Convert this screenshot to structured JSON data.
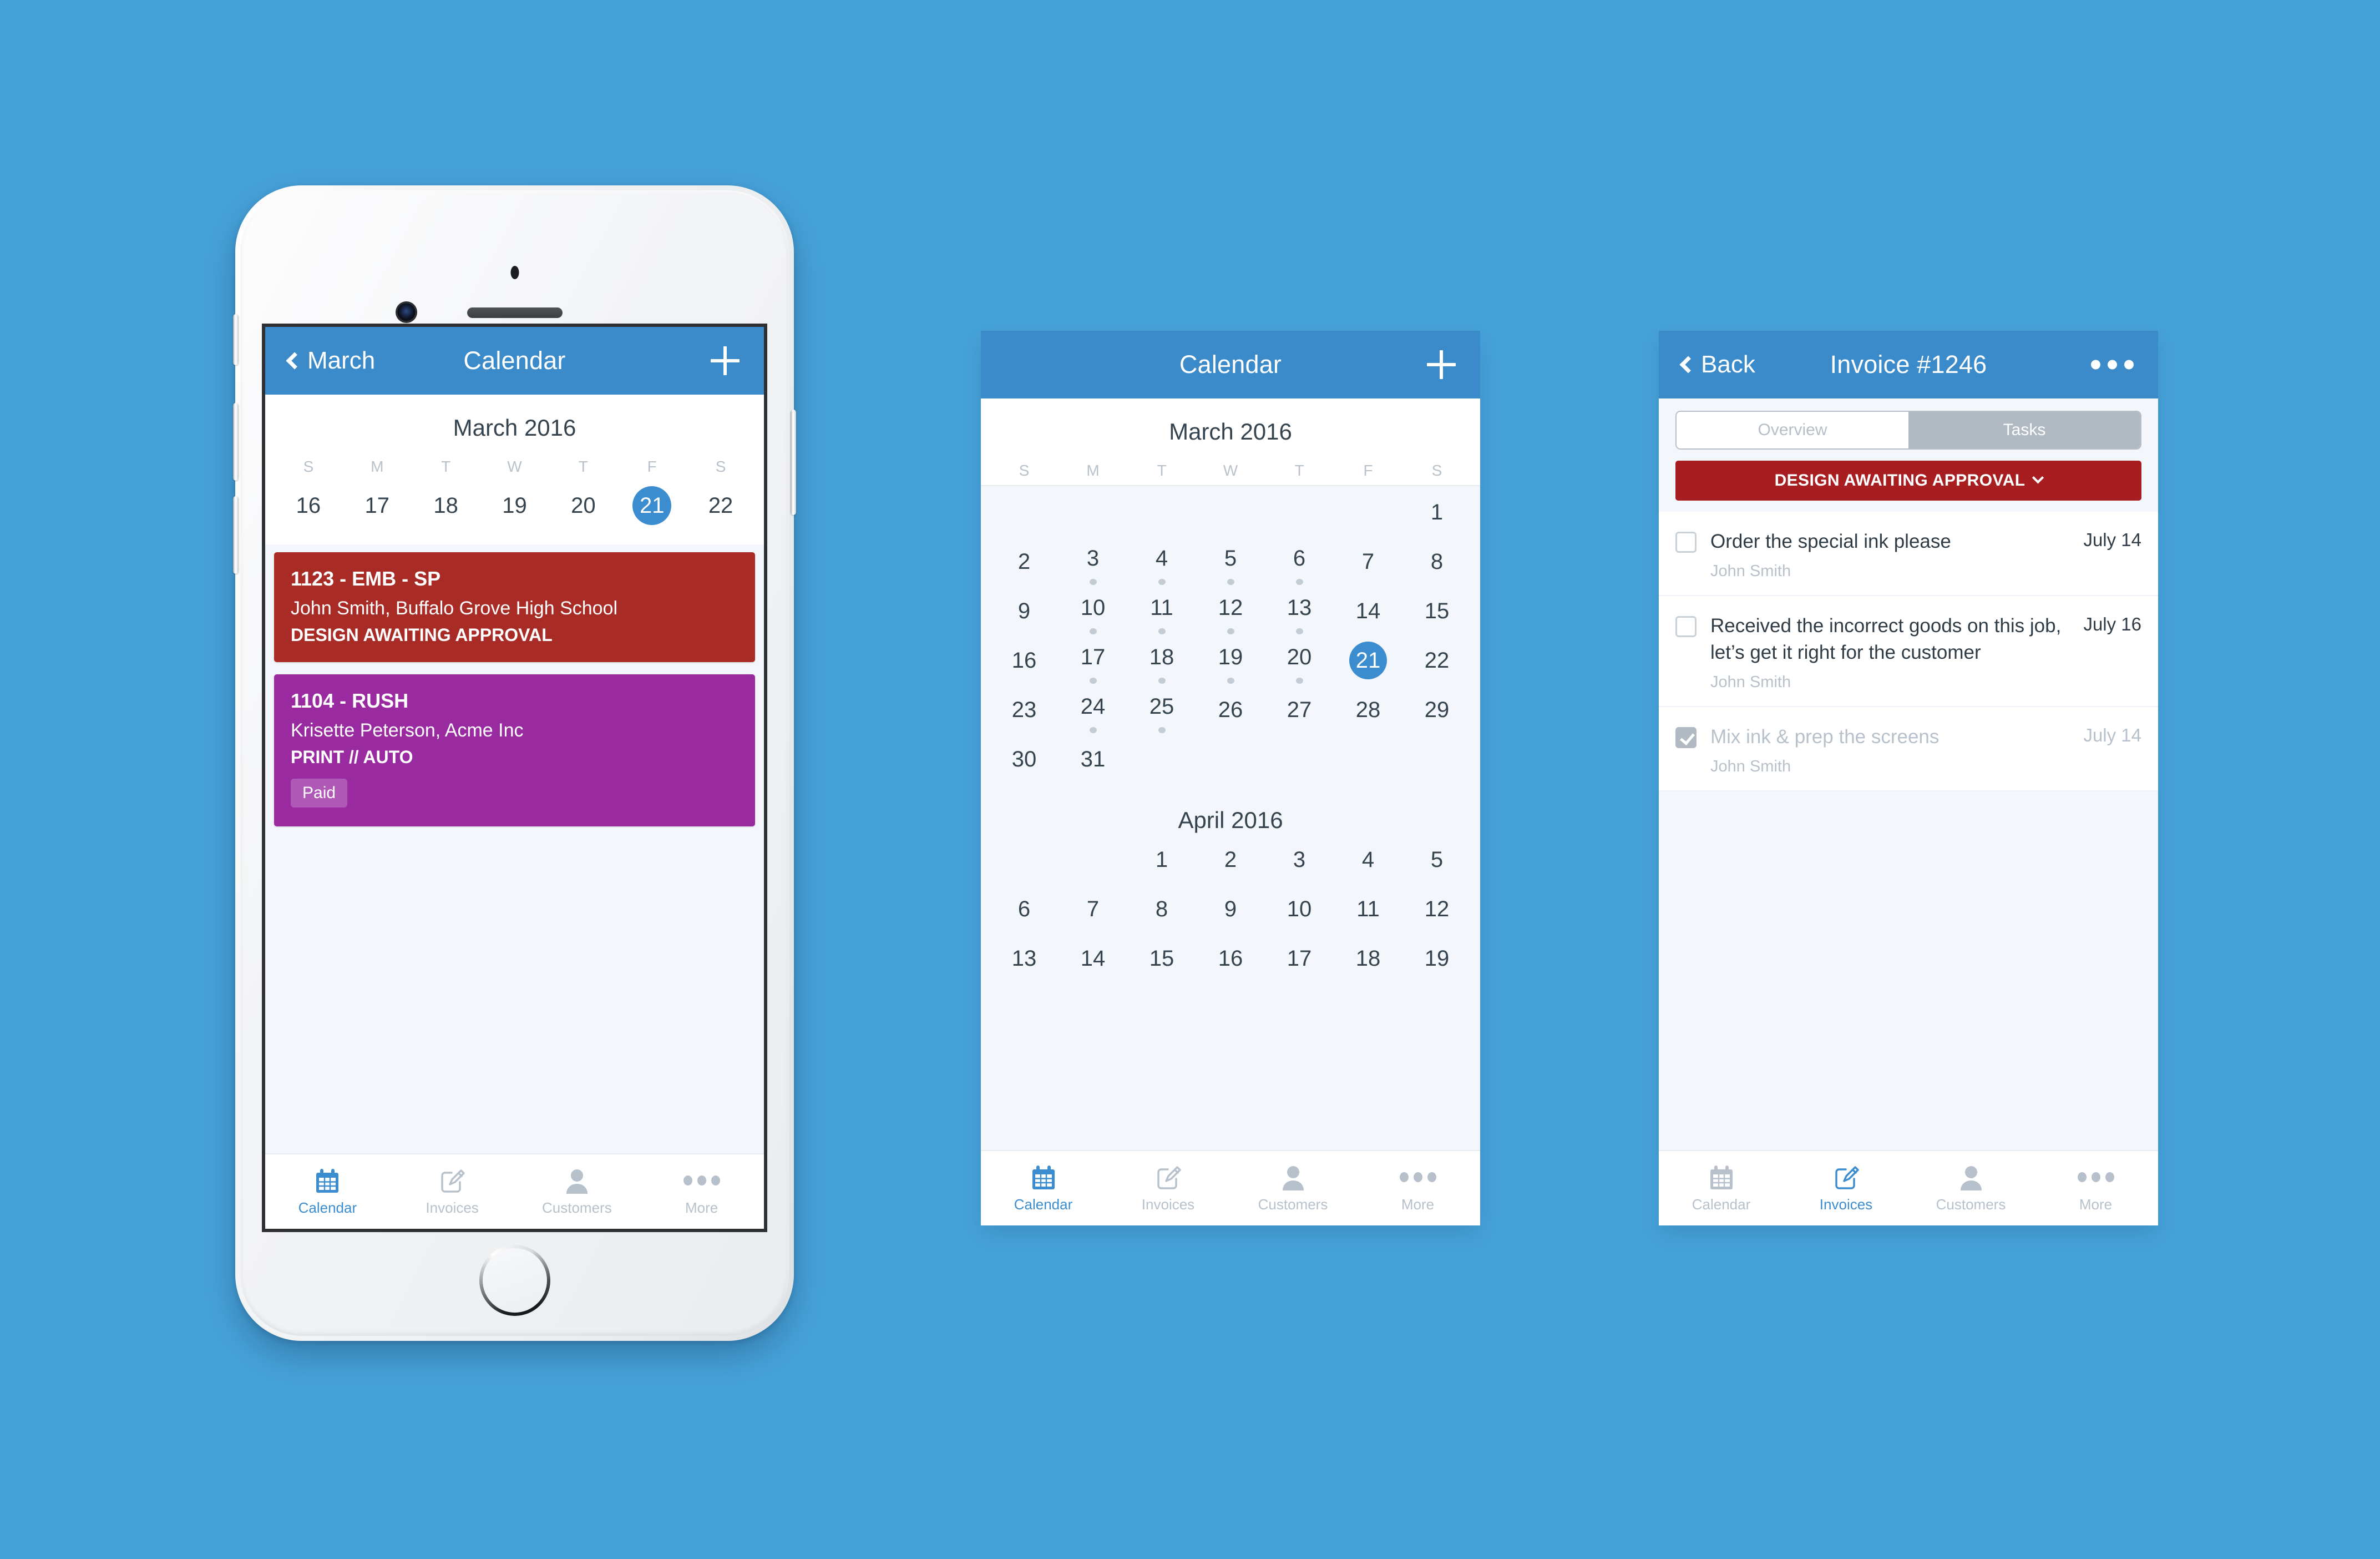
{
  "theme": {
    "page_background": "#47a2da",
    "navbar_blue": "#3b8ac9",
    "accent_blue": "#3c8dd0",
    "card_red": "#a82b25",
    "card_purple": "#9a2aa0",
    "status_red": "#a81e20",
    "muted_gray": "#b7c1cb"
  },
  "phone1": {
    "navbar": {
      "back_label": "March",
      "title": "Calendar",
      "add_icon": "plus-icon"
    },
    "month_title": "March 2016",
    "weekday_initials": [
      "S",
      "M",
      "T",
      "W",
      "T",
      "F",
      "S"
    ],
    "week_days": [
      {
        "day": "16",
        "today": false
      },
      {
        "day": "17",
        "today": false
      },
      {
        "day": "18",
        "today": false
      },
      {
        "day": "19",
        "today": false
      },
      {
        "day": "20",
        "today": false
      },
      {
        "day": "21",
        "today": true
      },
      {
        "day": "22",
        "today": false
      }
    ],
    "events": [
      {
        "color": "red",
        "title": "1123 - EMB - SP",
        "subtitle": "John Smith, Buffalo Grove High School",
        "status": "DESIGN AWAITING APPROVAL",
        "badge": null
      },
      {
        "color": "purple",
        "title": "1104 - RUSH",
        "subtitle": "Krisette Peterson, Acme Inc",
        "status": "PRINT // AUTO",
        "badge": "Paid"
      }
    ],
    "tabs": [
      {
        "label": "Calendar",
        "icon": "calendar-icon",
        "active": true
      },
      {
        "label": "Invoices",
        "icon": "invoice-pencil-icon",
        "active": false
      },
      {
        "label": "Customers",
        "icon": "person-icon",
        "active": false
      },
      {
        "label": "More",
        "icon": "ellipsis-icon",
        "active": false
      }
    ]
  },
  "phone2": {
    "navbar": {
      "title": "Calendar",
      "add_icon": "plus-icon"
    },
    "weekday_initials": [
      "S",
      "M",
      "T",
      "W",
      "T",
      "F",
      "S"
    ],
    "months": [
      {
        "title": "March 2016",
        "lead_blanks": 6,
        "days": [
          {
            "day": "1",
            "dot": false,
            "today": false
          },
          {
            "day": "2",
            "dot": false,
            "today": false
          },
          {
            "day": "3",
            "dot": true,
            "today": false
          },
          {
            "day": "4",
            "dot": true,
            "today": false
          },
          {
            "day": "5",
            "dot": true,
            "today": false
          },
          {
            "day": "6",
            "dot": true,
            "today": false
          },
          {
            "day": "7",
            "dot": false,
            "today": false
          },
          {
            "day": "8",
            "dot": false,
            "today": false
          },
          {
            "day": "9",
            "dot": false,
            "today": false
          },
          {
            "day": "10",
            "dot": true,
            "today": false
          },
          {
            "day": "11",
            "dot": true,
            "today": false
          },
          {
            "day": "12",
            "dot": true,
            "today": false
          },
          {
            "day": "13",
            "dot": true,
            "today": false
          },
          {
            "day": "14",
            "dot": false,
            "today": false
          },
          {
            "day": "15",
            "dot": false,
            "today": false
          },
          {
            "day": "16",
            "dot": false,
            "today": false
          },
          {
            "day": "17",
            "dot": true,
            "today": false
          },
          {
            "day": "18",
            "dot": true,
            "today": false
          },
          {
            "day": "19",
            "dot": true,
            "today": false
          },
          {
            "day": "20",
            "dot": true,
            "today": false
          },
          {
            "day": "21",
            "dot": false,
            "today": true
          },
          {
            "day": "22",
            "dot": false,
            "today": false
          },
          {
            "day": "23",
            "dot": false,
            "today": false
          },
          {
            "day": "24",
            "dot": true,
            "today": false
          },
          {
            "day": "25",
            "dot": true,
            "today": false
          },
          {
            "day": "26",
            "dot": false,
            "today": false
          },
          {
            "day": "27",
            "dot": false,
            "today": false
          },
          {
            "day": "28",
            "dot": false,
            "today": false
          },
          {
            "day": "29",
            "dot": false,
            "today": false
          },
          {
            "day": "30",
            "dot": false,
            "today": false
          },
          {
            "day": "31",
            "dot": false,
            "today": false
          }
        ]
      },
      {
        "title": "April 2016",
        "lead_blanks": 2,
        "days": [
          {
            "day": "1",
            "dot": false,
            "today": false
          },
          {
            "day": "2",
            "dot": false,
            "today": false
          },
          {
            "day": "3",
            "dot": false,
            "today": false
          },
          {
            "day": "4",
            "dot": false,
            "today": false
          },
          {
            "day": "5",
            "dot": false,
            "today": false
          },
          {
            "day": "6",
            "dot": false,
            "today": false
          },
          {
            "day": "7",
            "dot": false,
            "today": false
          },
          {
            "day": "8",
            "dot": false,
            "today": false
          },
          {
            "day": "9",
            "dot": false,
            "today": false
          },
          {
            "day": "10",
            "dot": false,
            "today": false
          },
          {
            "day": "11",
            "dot": false,
            "today": false
          },
          {
            "day": "12",
            "dot": false,
            "today": false
          },
          {
            "day": "13",
            "dot": false,
            "today": false
          },
          {
            "day": "14",
            "dot": false,
            "today": false
          },
          {
            "day": "15",
            "dot": false,
            "today": false
          },
          {
            "day": "16",
            "dot": false,
            "today": false
          },
          {
            "day": "17",
            "dot": false,
            "today": false
          },
          {
            "day": "18",
            "dot": false,
            "today": false
          },
          {
            "day": "19",
            "dot": false,
            "today": false
          }
        ]
      }
    ],
    "tabs": [
      {
        "label": "Calendar",
        "icon": "calendar-icon",
        "active": true
      },
      {
        "label": "Invoices",
        "icon": "invoice-pencil-icon",
        "active": false
      },
      {
        "label": "Customers",
        "icon": "person-icon",
        "active": false
      },
      {
        "label": "More",
        "icon": "ellipsis-icon",
        "active": false
      }
    ]
  },
  "phone3": {
    "navbar": {
      "back_label": "Back",
      "title": "Invoice #1246",
      "more_icon": "ellipsis-icon"
    },
    "segments": [
      {
        "label": "Overview",
        "selected": false
      },
      {
        "label": "Tasks",
        "selected": true
      }
    ],
    "status_button": {
      "label": "DESIGN AWAITING APPROVAL",
      "icon": "chevron-down-icon"
    },
    "tasks": [
      {
        "title": "Order the special ink please",
        "owner": "John Smith",
        "date": "July 14",
        "done": false
      },
      {
        "title": "Received the incorrect goods on this job, let’s get it right for the customer",
        "owner": "John Smith",
        "date": "July 16",
        "done": false
      },
      {
        "title": "Mix ink & prep the screens",
        "owner": "John Smith",
        "date": "July 14",
        "done": true
      }
    ],
    "tabs": [
      {
        "label": "Calendar",
        "icon": "calendar-icon",
        "active": false
      },
      {
        "label": "Invoices",
        "icon": "invoice-pencil-icon",
        "active": true
      },
      {
        "label": "Customers",
        "icon": "person-icon",
        "active": false
      },
      {
        "label": "More",
        "icon": "ellipsis-icon",
        "active": false
      }
    ]
  }
}
